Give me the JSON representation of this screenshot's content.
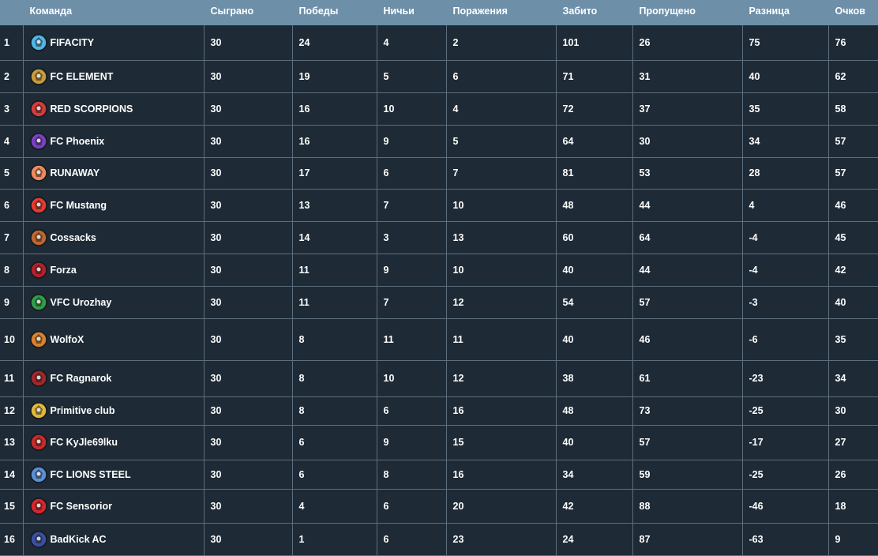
{
  "header": {
    "pos": "",
    "team": "Команда",
    "played": "Сыграно",
    "wins": "Победы",
    "draws": "Ничьи",
    "losses": "Поражения",
    "scored": "Забито",
    "conceded": "Пропущено",
    "diff": "Разница",
    "points": "Очков"
  },
  "rows": [
    {
      "pos": "1",
      "team": "FIFACITY",
      "played": "30",
      "wins": "24",
      "draws": "4",
      "losses": "2",
      "scored": "101",
      "conceded": "26",
      "diff": "75",
      "points": "76",
      "icon": "fifacity-logo-icon",
      "color": "#4fb7e6"
    },
    {
      "pos": "2",
      "team": "FC ELEMENT",
      "played": "30",
      "wins": "19",
      "draws": "5",
      "losses": "6",
      "scored": "71",
      "conceded": "31",
      "diff": "40",
      "points": "62",
      "icon": "fc-element-logo-icon",
      "color": "#c99a3b"
    },
    {
      "pos": "3",
      "team": "RED SCORPIONS",
      "played": "30",
      "wins": "16",
      "draws": "10",
      "losses": "4",
      "scored": "72",
      "conceded": "37",
      "diff": "35",
      "points": "58",
      "icon": "red-scorpions-logo-icon",
      "color": "#d63b3b"
    },
    {
      "pos": "4",
      "team": "FC Phoenix",
      "played": "30",
      "wins": "16",
      "draws": "9",
      "losses": "5",
      "scored": "64",
      "conceded": "30",
      "diff": "34",
      "points": "57",
      "icon": "fc-phoenix-logo-icon",
      "color": "#7b3fc4"
    },
    {
      "pos": "5",
      "team": "RUNAWAY",
      "played": "30",
      "wins": "17",
      "draws": "6",
      "losses": "7",
      "scored": "81",
      "conceded": "53",
      "diff": "28",
      "points": "57",
      "icon": "runaway-logo-icon",
      "color": "#f08a5d"
    },
    {
      "pos": "6",
      "team": "FC Mustang",
      "played": "30",
      "wins": "13",
      "draws": "7",
      "losses": "10",
      "scored": "48",
      "conceded": "44",
      "diff": "4",
      "points": "46",
      "icon": "fc-mustang-logo-icon",
      "color": "#e23b2e"
    },
    {
      "pos": "7",
      "team": "Cossacks",
      "played": "30",
      "wins": "14",
      "draws": "3",
      "losses": "13",
      "scored": "60",
      "conceded": "64",
      "diff": "-4",
      "points": "45",
      "icon": "cossacks-logo-icon",
      "color": "#c0662c"
    },
    {
      "pos": "8",
      "team": "Forza",
      "played": "30",
      "wins": "11",
      "draws": "9",
      "losses": "10",
      "scored": "40",
      "conceded": "44",
      "diff": "-4",
      "points": "42",
      "icon": "forza-logo-icon",
      "color": "#b3202a"
    },
    {
      "pos": "9",
      "team": "VFC Urozhay",
      "played": "30",
      "wins": "11",
      "draws": "7",
      "losses": "12",
      "scored": "54",
      "conceded": "57",
      "diff": "-3",
      "points": "40",
      "icon": "vfc-urozhay-logo-icon",
      "color": "#2f9e44"
    },
    {
      "pos": "10",
      "team": "WolfoX",
      "played": "30",
      "wins": "8",
      "draws": "11",
      "losses": "11",
      "scored": "40",
      "conceded": "46",
      "diff": "-6",
      "points": "35",
      "icon": "wolfox-logo-icon",
      "color": "#d9822b"
    },
    {
      "pos": "11",
      "team": "FC Ragnarok",
      "played": "30",
      "wins": "8",
      "draws": "10",
      "losses": "12",
      "scored": "38",
      "conceded": "61",
      "diff": "-23",
      "points": "34",
      "icon": "fc-ragnarok-logo-icon",
      "color": "#a0282d"
    },
    {
      "pos": "12",
      "team": "Primitive club",
      "played": "30",
      "wins": "8",
      "draws": "6",
      "losses": "16",
      "scored": "48",
      "conceded": "73",
      "diff": "-25",
      "points": "30",
      "icon": "primitive-club-logo-icon",
      "color": "#e0b93a"
    },
    {
      "pos": "13",
      "team": "FC KyJle69lku",
      "played": "30",
      "wins": "6",
      "draws": "9",
      "losses": "15",
      "scored": "40",
      "conceded": "57",
      "diff": "-17",
      "points": "27",
      "icon": "fc-kyjle69lku-logo-icon",
      "color": "#c92a2a"
    },
    {
      "pos": "14",
      "team": "FC LIONS STEEL",
      "played": "30",
      "wins": "6",
      "draws": "8",
      "losses": "16",
      "scored": "34",
      "conceded": "59",
      "diff": "-25",
      "points": "26",
      "icon": "fc-lions-steel-logo-icon",
      "color": "#5b8fd6"
    },
    {
      "pos": "15",
      "team": "FC Sensorior",
      "played": "30",
      "wins": "4",
      "draws": "6",
      "losses": "20",
      "scored": "42",
      "conceded": "88",
      "diff": "-46",
      "points": "18",
      "icon": "fc-sensorior-logo-icon",
      "color": "#d6262b"
    },
    {
      "pos": "16",
      "team": "BadKick AC",
      "played": "30",
      "wins": "1",
      "draws": "6",
      "losses": "23",
      "scored": "24",
      "conceded": "87",
      "diff": "-63",
      "points": "9",
      "icon": "badkick-ac-logo-icon",
      "color": "#3b4fa3"
    }
  ],
  "colors": {
    "header_bg": "#6d8fa8",
    "row_bg": "#1e2a35",
    "grid": "#5d6f7e"
  }
}
